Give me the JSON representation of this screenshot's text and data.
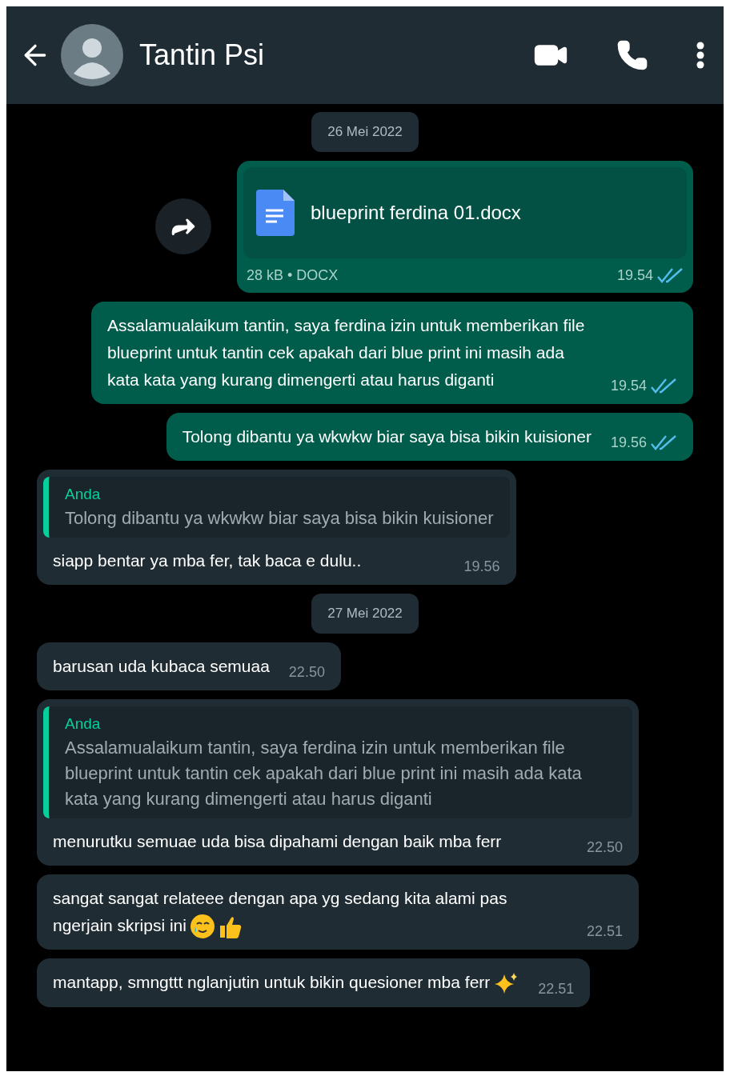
{
  "header": {
    "name": "Tantin Psi"
  },
  "messages": [
    {
      "kind": "date",
      "text": "26 Mei 2022"
    },
    {
      "kind": "file",
      "file_name": "blueprint ferdina 01.docx",
      "meta": "28 kB • DOCX",
      "time": "19.54",
      "read": true
    },
    {
      "kind": "sent",
      "text": "Assalamualaikum tantin, saya ferdina izin untuk memberikan file blueprint untuk tantin cek apakah dari blue print ini masih ada kata kata yang kurang dimengerti atau harus diganti",
      "time": "19.54",
      "read": true
    },
    {
      "kind": "sent",
      "text": "Tolong dibantu ya wkwkw biar saya bisa bikin kuisioner",
      "time": "19.56",
      "read": true
    },
    {
      "kind": "received",
      "quote": {
        "author": "Anda",
        "text": "Tolong dibantu ya wkwkw biar saya bisa bikin kuisioner"
      },
      "text": "siapp bentar ya mba fer, tak baca e dulu..",
      "time": "19.56"
    },
    {
      "kind": "date",
      "text": "27 Mei 2022"
    },
    {
      "kind": "received",
      "text": "barusan uda kubaca semuaa",
      "time": "22.50"
    },
    {
      "kind": "received",
      "quote": {
        "author": "Anda",
        "text": "Assalamualaikum tantin, saya ferdina izin untuk memberikan file blueprint untuk tantin cek apakah dari blue print ini masih ada kata kata yang kurang dimengerti atau harus diganti"
      },
      "text": "menurutku semuae uda bisa dipahami dengan baik mba ferr",
      "time": "22.50"
    },
    {
      "kind": "received",
      "text": "sangat sangat relateee dengan apa yg sedang kita alami pas ngerjain skripsi ini",
      "emojis": [
        {
          "kind": "tear"
        },
        {
          "kind": "thumb"
        }
      ],
      "time": "22.51"
    },
    {
      "kind": "received",
      "text": "mantapp, smngttt nglanjutin untuk bikin quesioner mba ferr",
      "emojis": [
        {
          "kind": "sparkles"
        }
      ],
      "time": "22.51"
    }
  ]
}
